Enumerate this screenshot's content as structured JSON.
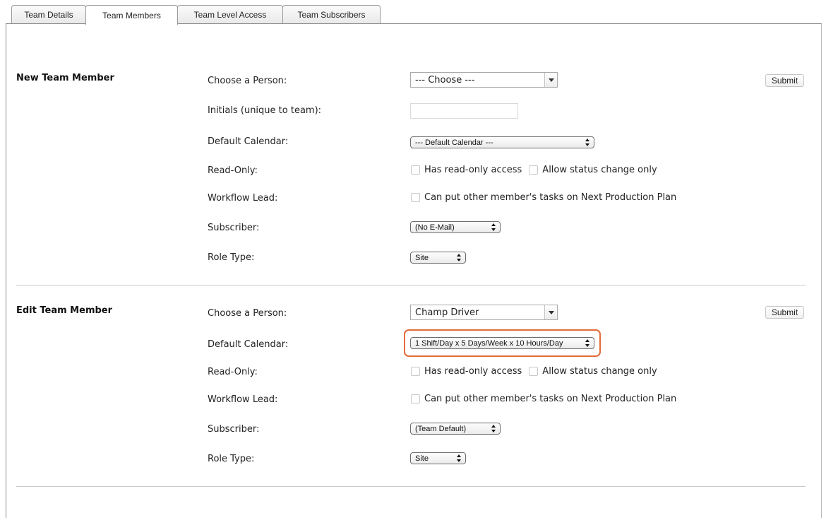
{
  "tabs": [
    {
      "label": "Team Details"
    },
    {
      "label": "Team Members"
    },
    {
      "label": "Team Level Access"
    },
    {
      "label": "Team Subscribers"
    }
  ],
  "new_member": {
    "title": "New Team Member",
    "labels": {
      "person": "Choose a Person:",
      "initials": "Initials (unique to team):",
      "calendar": "Default Calendar:",
      "readonly": "Read-Only:",
      "workflow": "Workflow Lead:",
      "subscriber": "Subscriber:",
      "role": "Role Type:"
    },
    "person_value": "--- Choose ---",
    "initials_value": "",
    "calendar_value": "--- Default Calendar ---",
    "readonly_options": [
      "Has read-only access",
      "Allow status change only"
    ],
    "workflow_option": "Can put other member's tasks on Next Production Plan",
    "subscriber_value": "(No E-Mail)",
    "role_value": "Site",
    "submit_label": "Submit"
  },
  "edit_member": {
    "title": "Edit Team Member",
    "labels": {
      "person": "Choose a Person:",
      "calendar": "Default Calendar:",
      "readonly": "Read-Only:",
      "workflow": "Workflow Lead:",
      "subscriber": "Subscriber:",
      "role": "Role Type:"
    },
    "person_value": "Champ Driver",
    "calendar_value": "1 Shift/Day x 5 Days/Week x 10 Hours/Day",
    "readonly_options": [
      "Has read-only access",
      "Allow status change only"
    ],
    "workflow_option": "Can put other member's tasks on Next Production Plan",
    "subscriber_value": "(Team Default)",
    "role_value": "Site",
    "submit_label": "Submit"
  },
  "colors": {
    "highlight": "#e46b3a"
  }
}
